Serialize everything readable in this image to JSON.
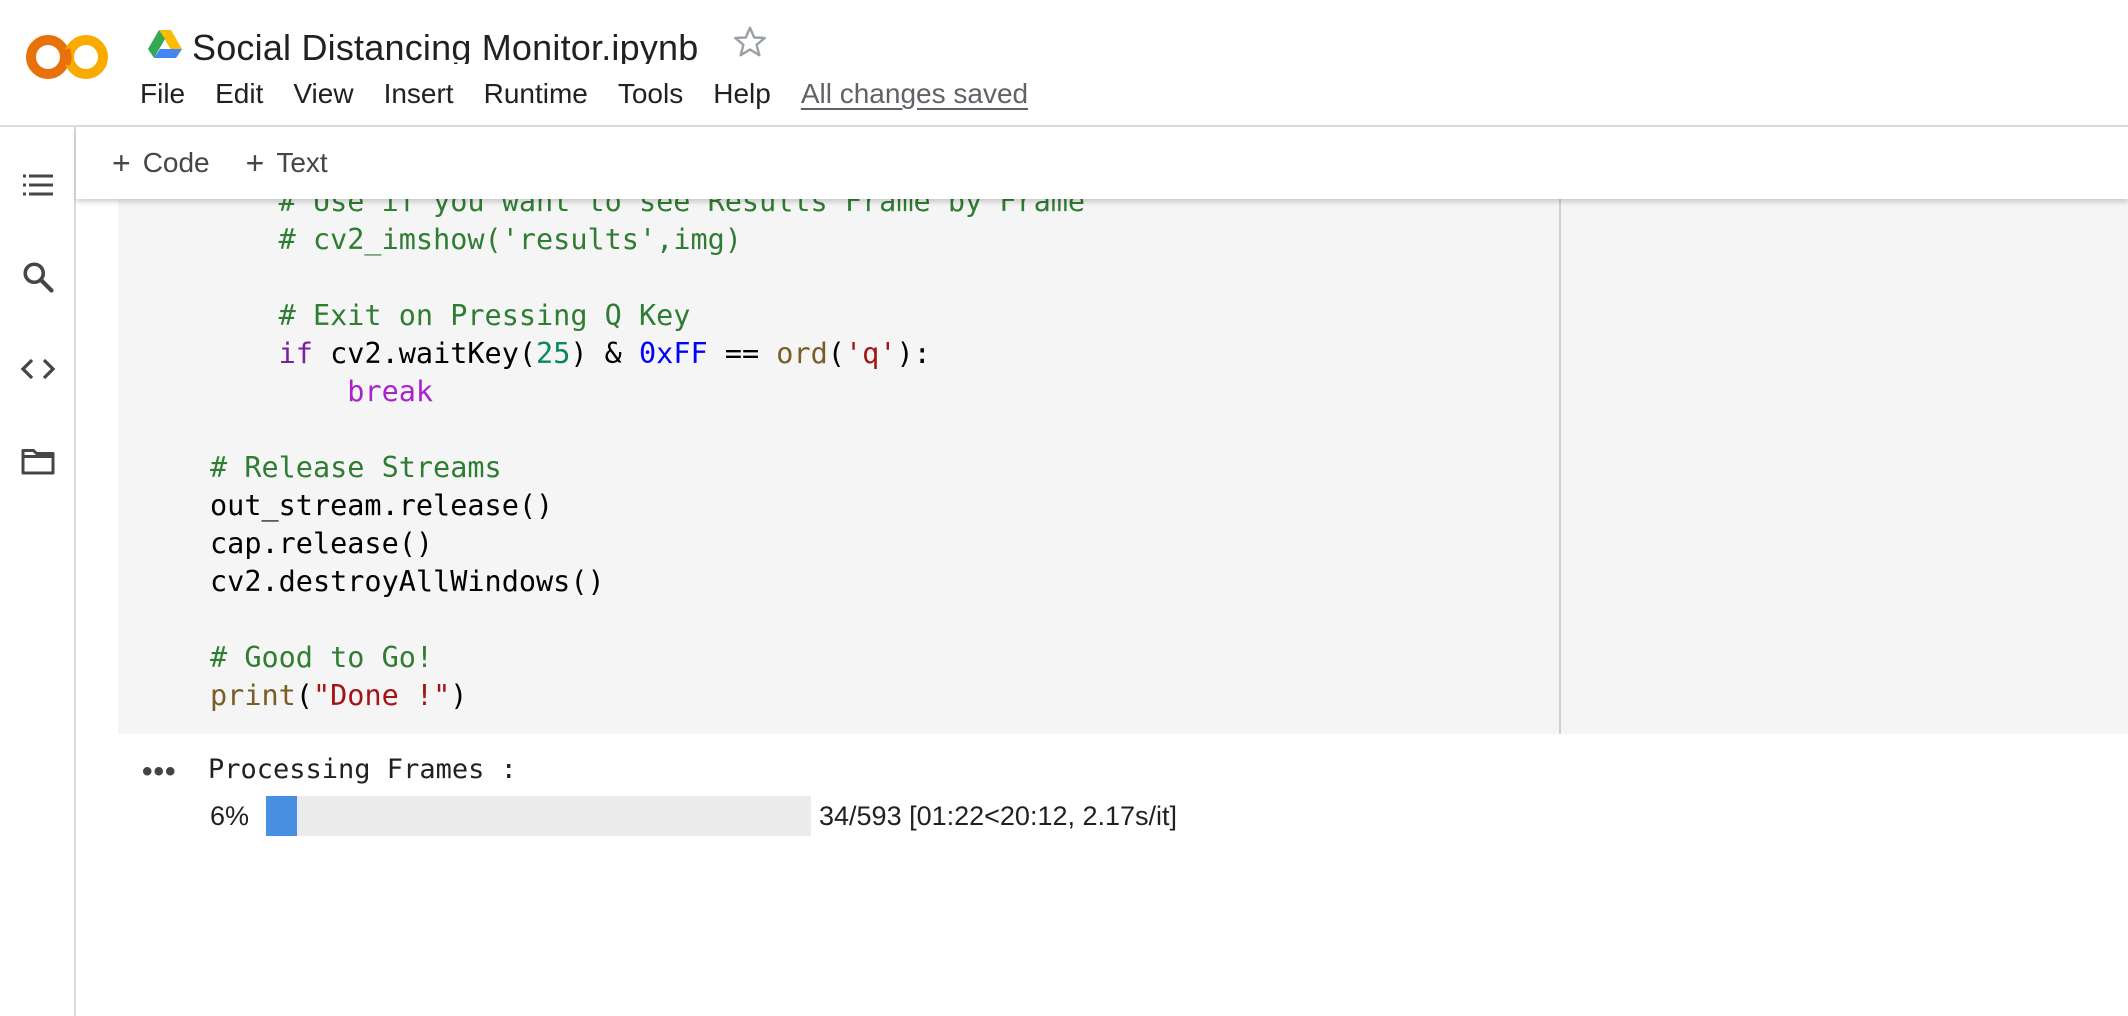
{
  "app": {
    "notebook_title": "Social Distancing Monitor.ipynb",
    "save_status": "All changes saved",
    "logo_text": "CO",
    "colors": {
      "logo_orange": "#f9ab00",
      "logo_dark_orange": "#e8710a",
      "progress_blue": "#4a90e2"
    }
  },
  "menu": {
    "items": [
      "File",
      "Edit",
      "View",
      "Insert",
      "Runtime",
      "Tools",
      "Help"
    ]
  },
  "toolbar": {
    "add_code": "Code",
    "add_text": "Text",
    "plus": "+"
  },
  "left_rail": {
    "icons": [
      "table-of-contents-icon",
      "search-icon",
      "code-snippets-icon",
      "files-folder-icon"
    ]
  },
  "code_cell": {
    "lines": [
      "    # Use if you want to see Results Frame by Frame",
      "    # cv2_imshow('results',img)",
      "",
      "    # Exit on Pressing Q Key",
      "    if cv2.waitKey(25) & 0xFF == ord('q'):",
      "        break",
      "",
      "# Release Streams",
      "out_stream.release()",
      "cap.release()",
      "cv2.destroyAllWindows()",
      "",
      "# Good to Go!",
      "print(\"Done !\")"
    ]
  },
  "output": {
    "dots": "•••",
    "label": "Processing Frames :",
    "progress_percent_text": "6%",
    "progress_fraction": 0.057,
    "progress_stats": "34/593 [01:22<20:12, 2.17s/it]"
  }
}
